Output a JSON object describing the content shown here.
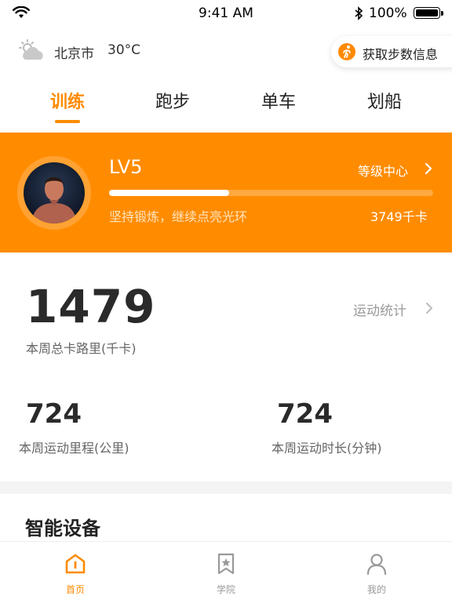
{
  "status_bar": {
    "time": "9:41 AM",
    "battery": "100%"
  },
  "weather": {
    "city": "北京市",
    "temperature": "30°C",
    "icon": "cloudy-sun-icon"
  },
  "steps_button": {
    "label": "获取步数信息",
    "icon": "running-icon"
  },
  "tabs": [
    {
      "label": "训练",
      "active": true
    },
    {
      "label": "跑步",
      "active": false
    },
    {
      "label": "单车",
      "active": false
    },
    {
      "label": "划船",
      "active": false
    }
  ],
  "level_card": {
    "level": "LV5",
    "center_link": "等级中心",
    "progress": 0.37,
    "motto": "坚持锻炼，继续点亮光环",
    "calories": "3749千卡"
  },
  "weekly": {
    "total_kcal": "1479",
    "total_kcal_label": "本周总卡路里(千卡)",
    "stats_link": "运动统计",
    "distance": "724",
    "distance_label": "本周运动里程(公里)",
    "duration": "724",
    "duration_label": "本周运动时长(分钟)"
  },
  "section": {
    "title": "智能设备"
  },
  "bottom_nav": [
    {
      "label": "首页",
      "icon": "home-icon",
      "active": true
    },
    {
      "label": "学院",
      "icon": "bookmark-star-icon",
      "active": false
    },
    {
      "label": "我的",
      "icon": "user-icon",
      "active": false
    }
  ],
  "colors": {
    "accent": "#ff8c00",
    "text": "#222222",
    "muted": "#999999"
  }
}
